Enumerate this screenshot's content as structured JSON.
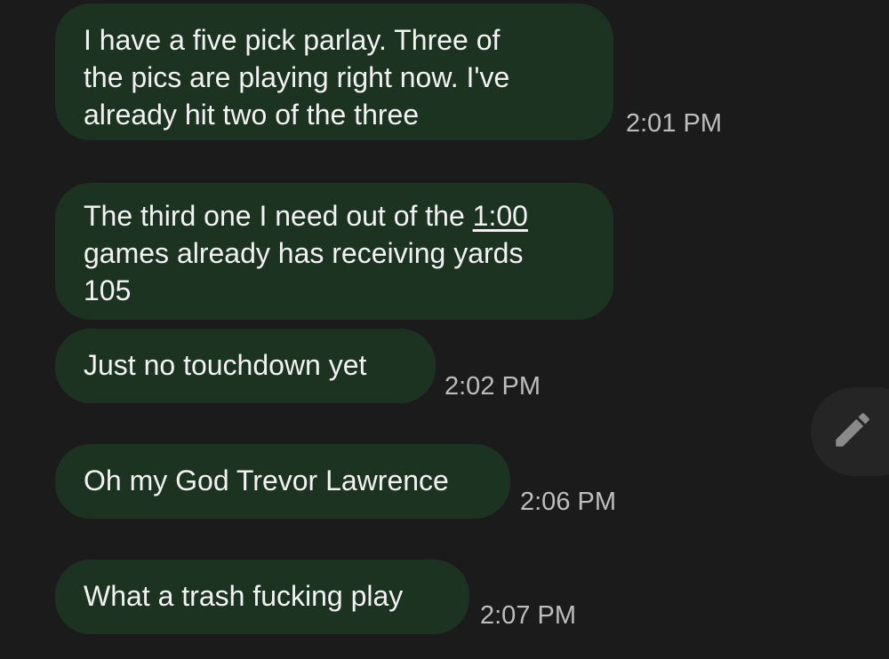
{
  "messages": [
    {
      "lines": [
        "I have a five pick parlay. Three of",
        "the pics are playing right now. I've",
        "already hit two of the three"
      ],
      "time": "2:01 PM"
    },
    {
      "line1_before": "The third one I need out of the ",
      "line1_link": "1:00",
      "lines_rest": [
        "games already has receiving yards",
        "105"
      ],
      "time": ""
    },
    {
      "lines": [
        "Just no touchdown yet"
      ],
      "time": "2:02 PM"
    },
    {
      "lines": [
        "Oh my God Trevor Lawrence"
      ],
      "time": "2:06 PM"
    },
    {
      "lines": [
        "What a trash fucking play"
      ],
      "time": "2:07 PM"
    }
  ],
  "compose_button": {
    "icon": "pencil-icon"
  },
  "colors": {
    "background": "#1b1b1c",
    "bubble": "#1d3322",
    "text": "#f2f2f2",
    "timestamp": "#bdbdbd"
  }
}
